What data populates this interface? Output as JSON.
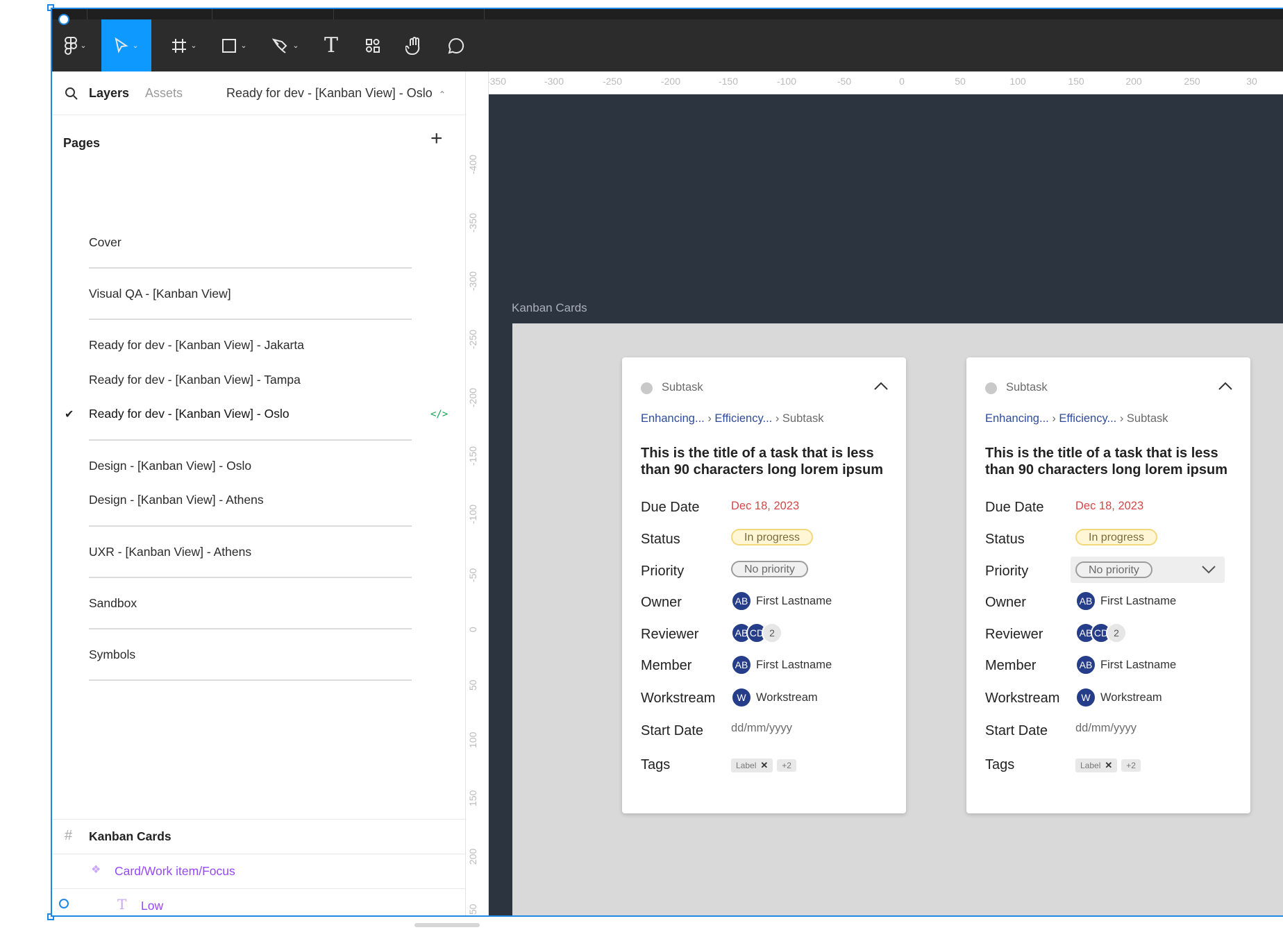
{
  "toolbar": {
    "tools": [
      "figma-menu",
      "move",
      "frame",
      "shape",
      "pen",
      "text",
      "resources",
      "hand",
      "comment"
    ],
    "text_tool_glyph": "T"
  },
  "left_panel": {
    "tabs": {
      "layers": "Layers",
      "assets": "Assets"
    },
    "current_page": "Ready for dev - [Kanban View] - Oslo",
    "pages_title": "Pages",
    "add_page": "+",
    "pages": [
      {
        "label": "Cover"
      },
      {
        "label": "Visual QA - [Kanban View]"
      },
      {
        "label": "Ready for dev  - [Kanban View] - Jakarta"
      },
      {
        "label": "Ready for dev  - [Kanban View] - Tampa"
      },
      {
        "label": "Ready for dev  - [Kanban View] - Oslo",
        "selected": true
      },
      {
        "label": "Design - [Kanban View] - Oslo"
      },
      {
        "label": "Design - [Kanban View] - Athens"
      },
      {
        "label": "UXR - [Kanban View] - Athens"
      },
      {
        "label": "Sandbox"
      },
      {
        "label": "Symbols"
      }
    ],
    "layers": [
      {
        "label": "Kanban Cards",
        "icon": "frame-icon"
      },
      {
        "label": "Card/Work item/Focus",
        "icon": "component-icon"
      },
      {
        "label": "Low",
        "icon": "text-layer-icon"
      }
    ]
  },
  "rulers": {
    "horizontal": [
      "-350",
      "-300",
      "-250",
      "-200",
      "-150",
      "-100",
      "-50",
      "0",
      "50",
      "100",
      "150",
      "200",
      "250",
      "30"
    ],
    "vertical": [
      "-400",
      "-350",
      "-300",
      "-250",
      "-200",
      "-150",
      "-100",
      "-50",
      "0",
      "50",
      "100",
      "150",
      "200",
      "50"
    ]
  },
  "canvas": {
    "frame_label": "Kanban Cards",
    "cards": [
      {
        "subtask_label": "Subtask",
        "breadcrumb": {
          "a": "Enhancing...",
          "b": "Efficiency...",
          "c": "Subtask"
        },
        "title": "This is the title of a task that is less than 90 characters long lorem ipsum",
        "fields": {
          "due_label": "Due Date",
          "due_value": "Dec 18, 2023",
          "status_label": "Status",
          "status_value": "In progress",
          "priority_label": "Priority",
          "priority_value": "No priority",
          "owner_label": "Owner",
          "owner_initials": "AB",
          "owner_name": "First Lastname",
          "reviewer_label": "Reviewer",
          "reviewer_a": "AB",
          "reviewer_b": "CD",
          "reviewer_count": "2",
          "member_label": "Member",
          "member_initials": "AB",
          "member_name": "First Lastname",
          "workstream_label": "Workstream",
          "workstream_initial": "W",
          "workstream_name": "Workstream",
          "start_label": "Start Date",
          "start_value": "dd/mm/yyyy",
          "tags_label": "Tags",
          "tag_label": "Label",
          "tag_more": "+2"
        }
      },
      {
        "subtask_label": "Subtask",
        "breadcrumb": {
          "a": "Enhancing...",
          "b": "Efficiency...",
          "c": "Subtask"
        },
        "title": "This is the title of a task that is less than 90 characters long lorem ipsum",
        "fields": {
          "due_label": "Due Date",
          "due_value": "Dec 18, 2023",
          "status_label": "Status",
          "status_value": "In progress",
          "priority_label": "Priority",
          "priority_value": "No priority",
          "owner_label": "Owner",
          "owner_initials": "AB",
          "owner_name": "First Lastname",
          "reviewer_label": "Reviewer",
          "reviewer_a": "AB",
          "reviewer_b": "CD",
          "reviewer_count": "2",
          "member_label": "Member",
          "member_initials": "AB",
          "member_name": "First Lastname",
          "workstream_label": "Workstream",
          "workstream_initial": "W",
          "workstream_name": "Workstream",
          "start_label": "Start Date",
          "start_value": "dd/mm/yyyy",
          "tags_label": "Tags",
          "tag_label": "Label",
          "tag_more": "+2"
        }
      }
    ]
  },
  "colors": {
    "accent": "#0d99ff",
    "selection": "#1e88e5",
    "toolbar": "#2c2c2c",
    "canvas": "#2c3440",
    "due_date": "#d64545",
    "avatar": "#263e8a",
    "component": "#9747ff"
  }
}
